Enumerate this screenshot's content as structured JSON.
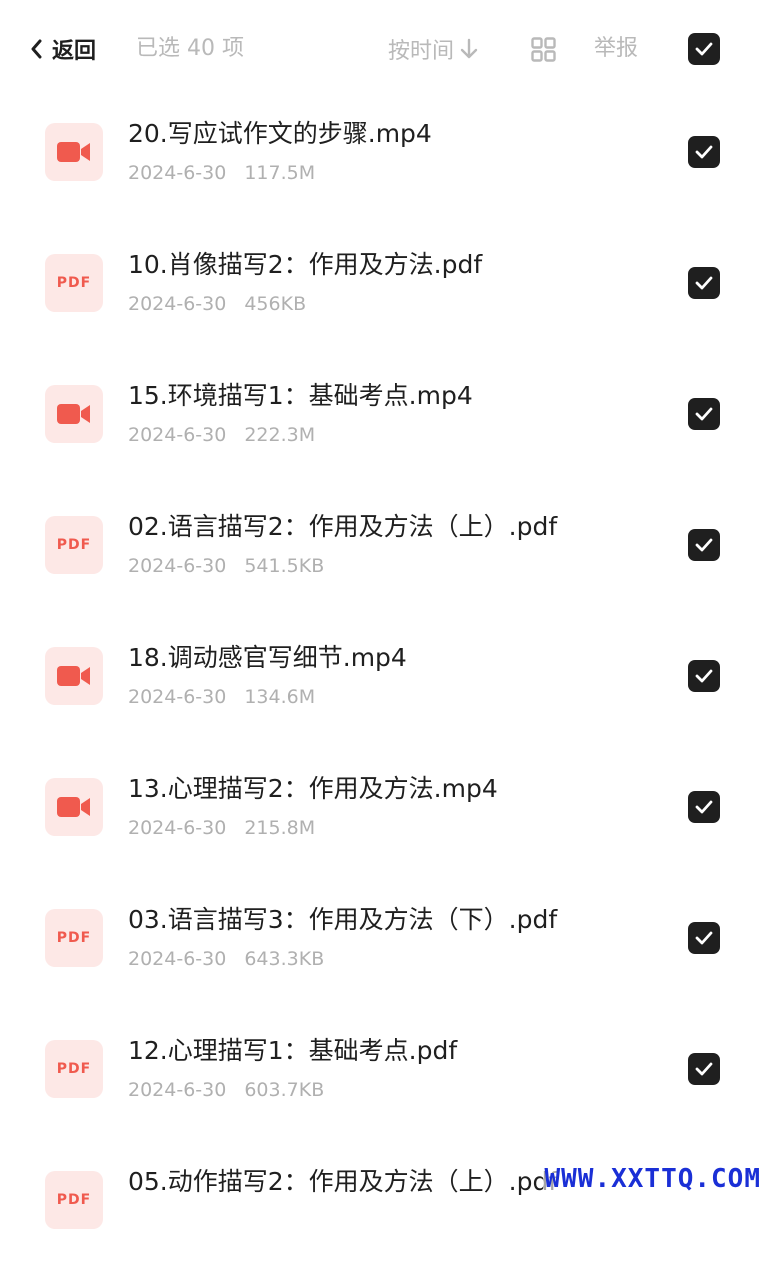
{
  "header": {
    "back_label": "返回",
    "selected_text": "已选 40 项",
    "sort_label": "按时间",
    "report_label": "举报"
  },
  "files": [
    {
      "name": "20.写应试作文的步骤.mp4",
      "date": "2024-6-30",
      "size": "117.5M",
      "type": "video"
    },
    {
      "name": "10.肖像描写2：作用及方法.pdf",
      "date": "2024-6-30",
      "size": "456KB",
      "type": "pdf"
    },
    {
      "name": "15.环境描写1：基础考点.mp4",
      "date": "2024-6-30",
      "size": "222.3M",
      "type": "video"
    },
    {
      "name": "02.语言描写2：作用及方法（上）.pdf",
      "date": "2024-6-30",
      "size": "541.5KB",
      "type": "pdf"
    },
    {
      "name": "18.调动感官写细节.mp4",
      "date": "2024-6-30",
      "size": "134.6M",
      "type": "video"
    },
    {
      "name": "13.心理描写2：作用及方法.mp4",
      "date": "2024-6-30",
      "size": "215.8M",
      "type": "video"
    },
    {
      "name": "03.语言描写3：作用及方法（下）.pdf",
      "date": "2024-6-30",
      "size": "643.3KB",
      "type": "pdf"
    },
    {
      "name": "12.心理描写1：基础考点.pdf",
      "date": "2024-6-30",
      "size": "603.7KB",
      "type": "pdf"
    },
    {
      "name": "05.动作描写2：作用及方法（上）.pdf",
      "date": "",
      "size": "",
      "type": "pdf"
    }
  ],
  "pdf_badge": "PDF",
  "watermark": "WWW.XXTTQ.COM",
  "colors": {
    "accent": "#f05a4e",
    "check": "#1f1f1f"
  }
}
